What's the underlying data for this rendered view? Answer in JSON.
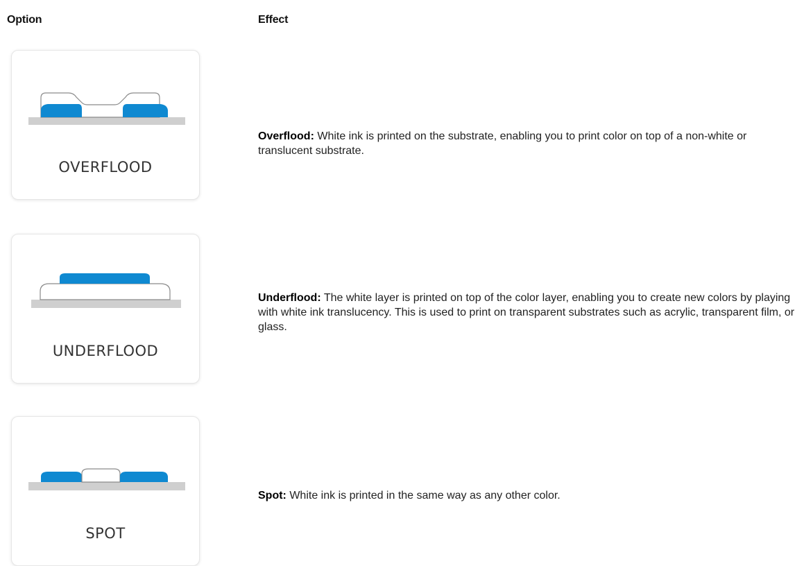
{
  "headers": {
    "option": "Option",
    "effect": "Effect"
  },
  "colors": {
    "ink_blue": "#0f89d1",
    "substrate_gray": "#cfcfcf",
    "white_ink_outline": "#8a8a8a"
  },
  "rows": [
    {
      "card_label": "OVERFLOOD",
      "term": "Overflood:",
      "description": " White ink is printed on the substrate, enabling you to print color on top of a non-white or translucent substrate."
    },
    {
      "card_label": "UNDERFLOOD",
      "term": "Underflood:",
      "description": " The white layer is printed on top of the color layer, enabling you to create new colors by playing with white ink translucency. This is used to print on transparent substrates such as acrylic, transparent film, or glass."
    },
    {
      "card_label": "SPOT",
      "term": "Spot:",
      "description": " White ink is printed in the same way as any other color."
    }
  ]
}
